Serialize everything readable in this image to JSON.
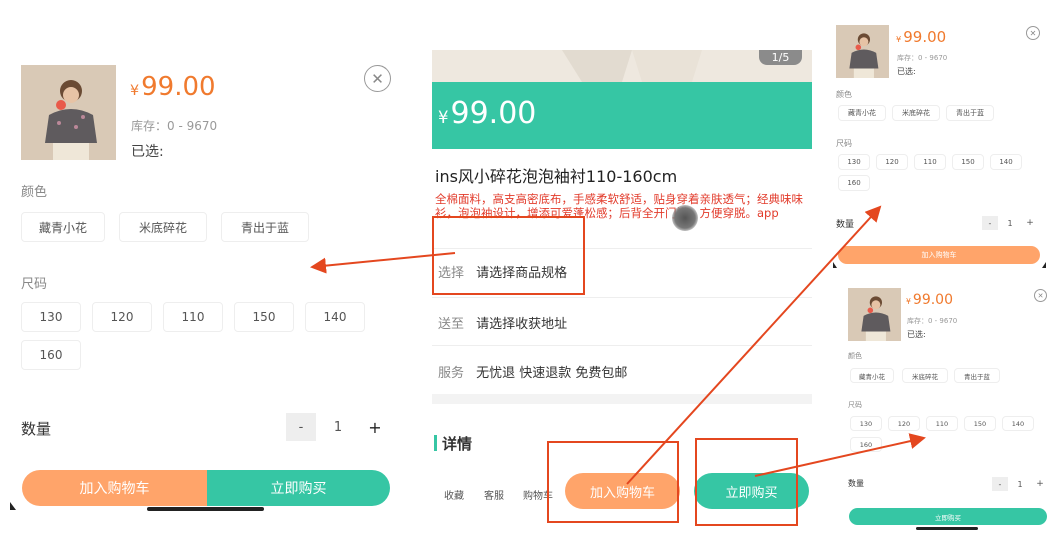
{
  "colors": {
    "price": "#f07a2e",
    "teal": "#36c6a4",
    "orange": "#ffa46a",
    "annotation": "#e4471f"
  },
  "sku_panel": {
    "price_symbol": "¥",
    "price": "99.00",
    "stock": "库存：0 - 9670",
    "selected": "已选:",
    "color_title": "颜色",
    "colors": [
      "藏青小花",
      "米底碎花",
      "青出于蓝"
    ],
    "size_title": "尺码",
    "sizes": [
      "130",
      "120",
      "110",
      "150",
      "140",
      "160"
    ],
    "qty_label": "数量",
    "qty_minus": "-",
    "qty_value": "1",
    "qty_plus": "+",
    "add_cart": "加入购物车",
    "buy_now": "立即购买"
  },
  "product": {
    "image_counter": "1/5",
    "price_symbol": "¥",
    "price": "99.00",
    "title": "ins风小碎花泡泡袖衬110-160cm",
    "desc": "全棉面料，高支高密底布，手感柔软舒适，贴身穿着亲肤透气；经典味味衫，泡泡袖设计，增添可爱蓬松感；后背全开门襟，方便穿脱。app",
    "rows": [
      {
        "label": "选择",
        "value": "请选择商品规格"
      },
      {
        "label": "送至",
        "value": "请选择收获地址"
      },
      {
        "label": "服务",
        "value": "无忧退 快速退款 免费包邮"
      }
    ],
    "details_title": "详情",
    "tabbar": [
      "收藏",
      "客服",
      "购物车"
    ],
    "add_cart": "加入购物车",
    "buy_now": "立即购买"
  }
}
